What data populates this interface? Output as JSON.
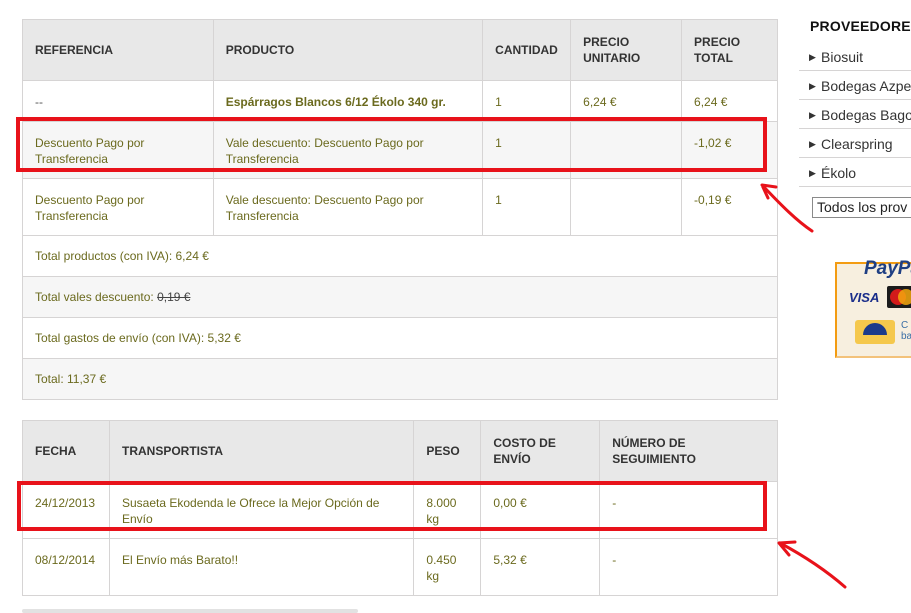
{
  "order_table": {
    "headers": {
      "referencia": "REFERENCIA",
      "producto": "PRODUCTO",
      "cantidad": "CANTIDAD",
      "precio_unitario_l1": "PRECIO",
      "precio_unitario_l2": "UNITARIO",
      "precio_total_l1": "PRECIO",
      "precio_total_l2": "TOTAL"
    },
    "rows": [
      {
        "referencia": "--",
        "producto": "Espárragos Blancos 6/12 Ékolo 340 gr.",
        "cantidad": "1",
        "precio_unitario": "6,24 €",
        "precio_total": "6,24 €"
      },
      {
        "referencia_l1": "Descuento Pago por",
        "referencia_l2": "Transferencia",
        "producto_l1": "Vale descuento: Descuento Pago por",
        "producto_l2": "Transferencia",
        "cantidad": "1",
        "precio_unitario": "",
        "precio_total": "-1,02 €"
      },
      {
        "referencia_l1": "Descuento Pago por",
        "referencia_l2": "Transferencia",
        "producto_l1": "Vale descuento: Descuento Pago por",
        "producto_l2": "Transferencia",
        "cantidad": "1",
        "precio_unitario": "",
        "precio_total": "-0,19 €"
      }
    ],
    "totals": {
      "productos": "Total productos (con IVA): 6,24 €",
      "vales_label": "Total vales descuento: ",
      "vales_value": "0,19 €",
      "envio": "Total gastos de envío (con IVA): 5,32 €",
      "total": "Total: 11,37 €"
    }
  },
  "shipping_table": {
    "headers": {
      "fecha": "FECHA",
      "transportista": "TRANSPORTISTA",
      "peso": "PESO",
      "costo_l1": "COSTO DE",
      "costo_l2": "ENVÍO",
      "numero_l1": "NÚMERO DE",
      "numero_l2": "SEGUIMIENTO"
    },
    "rows": [
      {
        "fecha": "24/12/2013",
        "transportista_l1": "Susaeta Ekodenda le Ofrece la Mejor Opción de",
        "transportista_l2": "Envío",
        "peso_l1": "8.000",
        "peso_l2": "kg",
        "costo": "0,00 €",
        "numero": "-"
      },
      {
        "fecha": "08/12/2014",
        "transportista_l1": "El Envío más Barato!!",
        "transportista_l2": "",
        "peso_l1": "0.450",
        "peso_l2": "kg",
        "costo": "5,32 €",
        "numero": "-"
      }
    ]
  },
  "sidebar": {
    "title": "PROVEEDORES",
    "brands": [
      "Biosuit",
      "Bodegas Azpe",
      "Bodegas Bago",
      "Clearspring",
      "Ékolo"
    ],
    "select_value": "Todos los prov",
    "payment": {
      "paypal": "PayPal",
      "visa": "VISA",
      "bank_text_l1": "C",
      "bank_text_l2": "ba"
    }
  },
  "annotation_colors": {
    "highlight": "#e8121a"
  }
}
